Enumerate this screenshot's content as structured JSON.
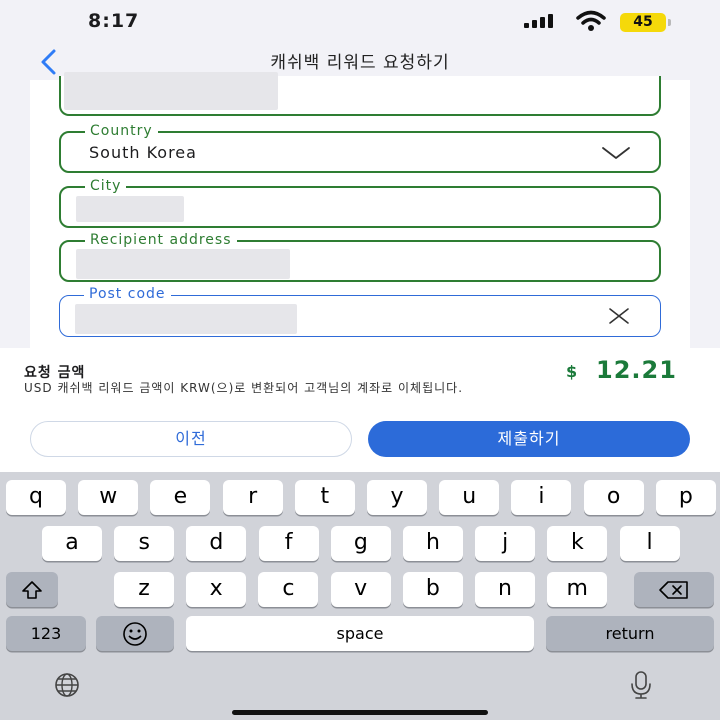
{
  "status_bar": {
    "time": "8:17",
    "battery": "45"
  },
  "nav": {
    "title": "캐쉬백 리워드 요청하기",
    "back_icon": "chevron-left-icon"
  },
  "form": {
    "country": {
      "label": "Country",
      "value": "South Korea"
    },
    "city": {
      "label": "City"
    },
    "recipient_address": {
      "label": "Recipient address"
    },
    "post_code": {
      "label": "Post code"
    }
  },
  "amount": {
    "title": "요청 금액",
    "note": "USD 캐쉬백 리워드 금액이 KRW(으)로 변환되어 고객님의 계좌로 이체됩니다.",
    "currency": "$",
    "value": "12.21"
  },
  "buttons": {
    "prev": "이전",
    "submit": "제출하기"
  },
  "keyboard": {
    "row1": [
      "q",
      "w",
      "e",
      "r",
      "t",
      "y",
      "u",
      "i",
      "o",
      "p"
    ],
    "row2": [
      "a",
      "s",
      "d",
      "f",
      "g",
      "h",
      "j",
      "k",
      "l"
    ],
    "row3": [
      "z",
      "x",
      "c",
      "v",
      "b",
      "n",
      "m"
    ],
    "numbers": "123",
    "space": "space",
    "return": "return"
  },
  "colors": {
    "accent_green": "#2e7d32",
    "accent_blue": "#2c6bd9",
    "amount_green": "#1b7a3a"
  }
}
